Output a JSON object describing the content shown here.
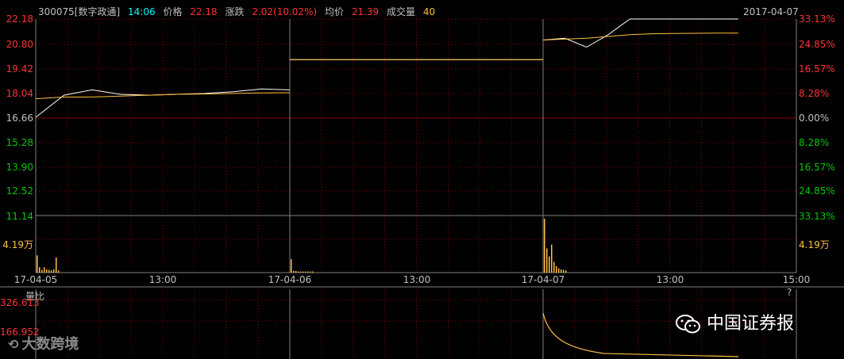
{
  "header": {
    "code_name": "300075[数字政通]",
    "time": "14:06",
    "price_label": "价格",
    "price": "22.18",
    "change_label": "涨跌",
    "change": "2.02(10.02%)",
    "avg_label": "均价",
    "avg": "21.39",
    "volume_label": "成交量",
    "volume": "40",
    "date": "2017-04-07"
  },
  "price_axis": [
    "22.18",
    "20.80",
    "19.42",
    "18.04",
    "16.66",
    "15.28",
    "13.90",
    "12.52",
    "11.14"
  ],
  "pct_axis": [
    "33.13%",
    "24.85%",
    "16.57%",
    "8.28%",
    "0.00%",
    "8.28%",
    "16.57%",
    "24.85%",
    "33.13%"
  ],
  "vol_axis_left": "4.19万",
  "vol_axis_right": "4.19万",
  "x_ticks": [
    "17-04-05",
    "13:00",
    "17-04-06",
    "13:00",
    "17-04-07",
    "13:00",
    "15:00"
  ],
  "ratio_panel": {
    "title": "量比",
    "top_value": "326.613",
    "mid_value": "166.952",
    "help": "?"
  },
  "watermarks": {
    "left": "大数跨境",
    "right": "中国证券报"
  },
  "colors": {
    "background": "#000000",
    "grid": "#8b0000",
    "up": "#ff3232",
    "down": "#00c800",
    "price_line": "#ffffff",
    "avg_line": "#ffc040",
    "volume": "#ffc040",
    "cyan": "#00ffff"
  },
  "chart_data": {
    "type": "line",
    "x": [
      "17-04-05",
      "13:00",
      "17-04-06",
      "13:00",
      "17-04-07",
      "13:00",
      "15:00"
    ],
    "prev_close": 16.66,
    "series": [
      {
        "name": "价格",
        "days": [
          [
            16.66,
            17.9,
            18.2,
            17.95,
            17.9,
            17.95,
            18.0,
            18.1,
            18.25,
            18.2
          ],
          [
            19.9,
            19.9,
            19.9,
            19.9,
            19.9,
            19.9,
            19.9,
            19.9,
            19.9,
            19.9
          ],
          [
            21.0,
            21.1,
            20.6,
            21.3,
            22.18,
            22.18,
            22.18,
            22.18,
            22.18,
            22.18
          ]
        ]
      },
      {
        "name": "均价",
        "days": [
          [
            17.7,
            17.8,
            17.8,
            17.85,
            17.9,
            17.95,
            17.97,
            18.0,
            18.03,
            18.04
          ],
          [
            19.9,
            19.9,
            19.9,
            19.9,
            19.9,
            19.9,
            19.9,
            19.9,
            19.9,
            19.9
          ],
          [
            21.0,
            21.05,
            21.1,
            21.2,
            21.3,
            21.35,
            21.37,
            21.38,
            21.39,
            21.39
          ]
        ]
      }
    ],
    "ylim": [
      11.14,
      22.18
    ],
    "volume_max_wan": 4.19,
    "volume_bars": [
      0.32,
      0.1,
      0.05,
      0.1,
      0.06,
      0.05,
      0.04,
      0.06,
      0.28,
      0.04,
      0.25,
      0.03,
      0.03,
      0.02,
      0.02,
      0.02,
      0.02,
      0.02,
      0.02,
      0.02,
      1.0,
      0.45,
      0.3,
      0.52,
      0.2,
      0.12,
      0.08,
      0.06,
      0.05,
      0.04
    ]
  }
}
